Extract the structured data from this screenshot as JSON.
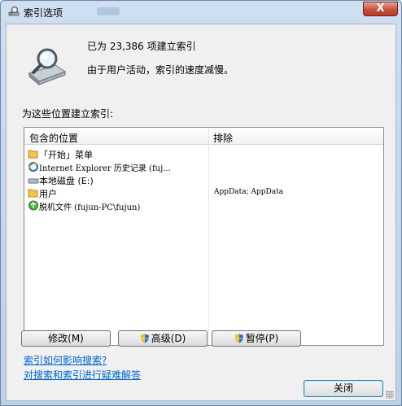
{
  "window": {
    "title": "索引选项",
    "close_symbol": "X"
  },
  "status": {
    "indexed_count_line": "已为 23,386 项建立索引",
    "activity_line": "由于用户活动，索引的速度减慢。"
  },
  "section_label": "为这些位置建立索引:",
  "table": {
    "columns": [
      "包含的位置",
      "排除"
    ],
    "rows": [
      {
        "icon": "folder-icon",
        "name": "「开始」菜单",
        "exclude": ""
      },
      {
        "icon": "ie-icon",
        "name": "Internet Explorer 历史记录 (fuj...",
        "exclude": ""
      },
      {
        "icon": "drive-icon",
        "name": "本地磁盘 (E:)",
        "exclude": ""
      },
      {
        "icon": "folder-icon",
        "name": "用户",
        "exclude": "AppData; AppData"
      },
      {
        "icon": "offline-files-icon",
        "name": "脱机文件 (fujun-PC\\fujun)",
        "exclude": ""
      }
    ]
  },
  "buttons": {
    "modify": "修改(M)",
    "advanced": "高级(D)",
    "pause": "暂停(P)",
    "close": "关闭"
  },
  "links": {
    "how_indexing": "索引如何影响搜索?",
    "troubleshoot": "对搜索和索引进行疑难解答"
  },
  "colors": {
    "link": "#0066cc",
    "close_button": "#c8503b"
  }
}
